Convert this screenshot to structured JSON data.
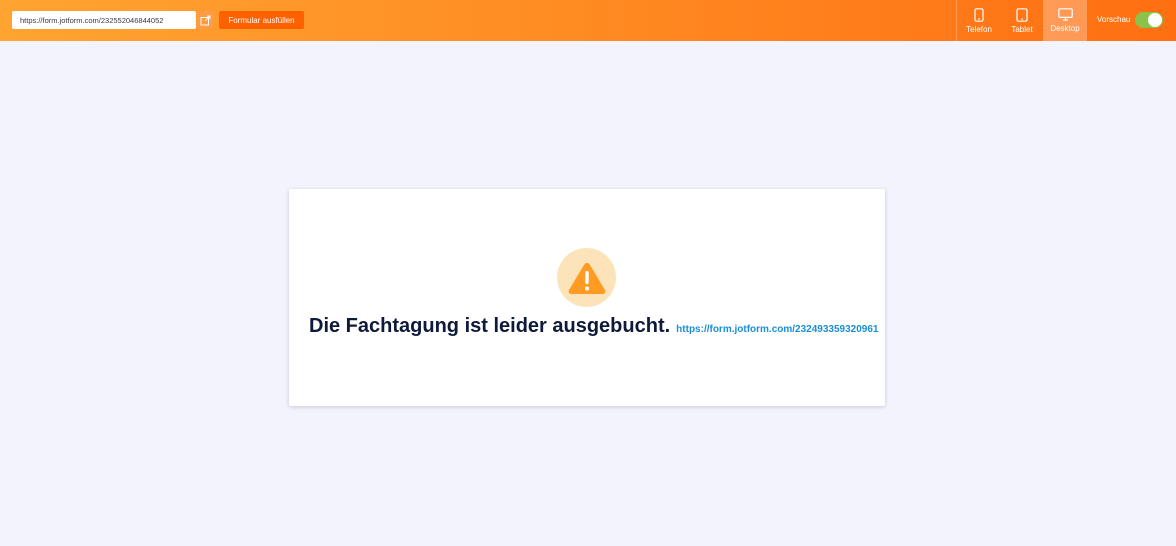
{
  "toolbar": {
    "url_value": "https://form.jotform.com/232552046844052",
    "open_link_icon": "external-link-icon",
    "fill_button_label": "Formular ausfüllen",
    "devices": [
      {
        "label": "Telefon",
        "icon": "phone-icon",
        "active": false
      },
      {
        "label": "Tablet",
        "icon": "tablet-icon",
        "active": false
      },
      {
        "label": "Desktop",
        "icon": "desktop-icon",
        "active": true
      }
    ],
    "preview_label": "Vorschau",
    "preview_enabled": true,
    "colors": {
      "gradient_start": "#ffa431",
      "gradient_end": "#ff6f12",
      "fill_button": "#ff6100",
      "toggle_on": "#8bc34a"
    }
  },
  "card": {
    "icon": "warning-icon",
    "headline": "Die Fachtagung ist leider ausgebucht.",
    "link_text": "https://form.jotform.com/232493359320961",
    "colors": {
      "icon_circle": "#fde3ba",
      "icon": "#ff9b22",
      "headline": "#0f1a3a",
      "link": "#1a8ed6"
    }
  }
}
